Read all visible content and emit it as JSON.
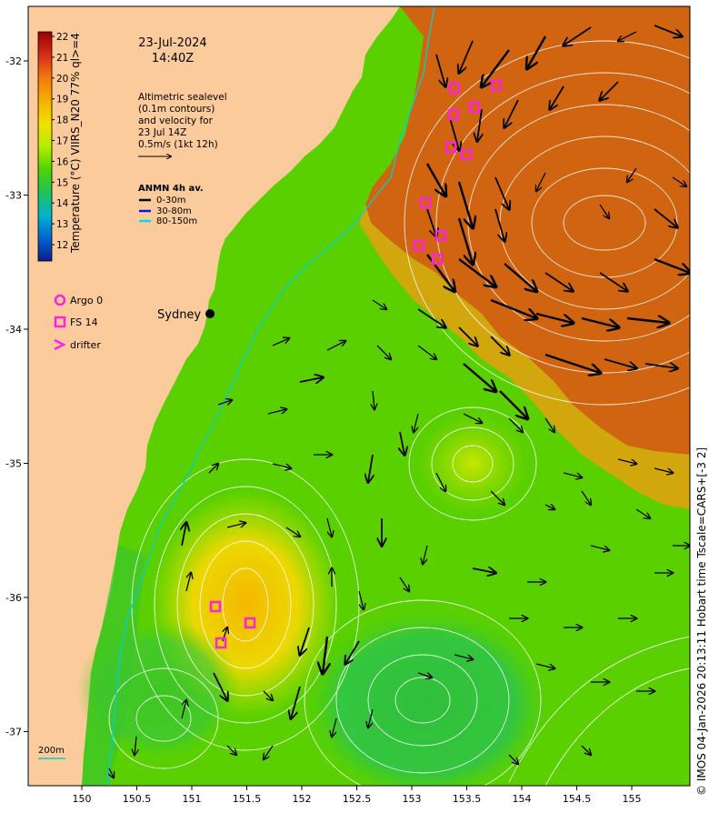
{
  "map": {
    "date": "23-Jul-2024",
    "time": "14:40Z",
    "altimetry_note": [
      "Altimetric sealevel",
      "(0.1m contours)",
      "and velocity for",
      "23 Jul 14Z",
      "0.5m/s (1kt 12h)"
    ],
    "anmn": {
      "title": "ANMN 4h av.",
      "items": [
        {
          "label": "0-30m",
          "color": "#000000"
        },
        {
          "label": "30-80m",
          "color": "#1010e0"
        },
        {
          "label": "80-150m",
          "color": "#00e0e0"
        }
      ]
    },
    "colorbar": {
      "label": "Temperature (°C) VIIRS_N20 77% ql>=4",
      "ticks": [
        "22",
        "21",
        "20",
        "19",
        "18",
        "17",
        "16",
        "15",
        "14",
        "13",
        "12"
      ],
      "colors": [
        "#ae0000",
        "#d8301c",
        "#f07a10",
        "#f5ad00",
        "#f3dc00",
        "#b6ec00",
        "#55d800",
        "#22c65a",
        "#00b6c8",
        "#007ad8",
        "#0b2a9a"
      ]
    },
    "markers": {
      "argo": "Argo 0",
      "fs": "FS 14",
      "drifter": "drifter"
    },
    "city": "Sydney",
    "scale_label": "200m",
    "x_ticks": [
      "150",
      "150.5",
      "151",
      "151.5",
      "152",
      "152.5",
      "153",
      "153.5",
      "154",
      "154.5",
      "155"
    ],
    "y_ticks": [
      "-32",
      "-33",
      "-34",
      "-35",
      "-36",
      "-37"
    ],
    "credit": "© IMOS 04-Jan-2026 20:13:11 Hobart time Tscale=CARS+[-3 2]",
    "colors": {
      "land": "#fbcb9c",
      "warm_core": "#d06410",
      "shelf_green": "#5ad000",
      "cool_green": "#2fc040",
      "yellow": "#e6e800",
      "magenta": "#ff22dd",
      "current": "#00d0d0"
    }
  }
}
